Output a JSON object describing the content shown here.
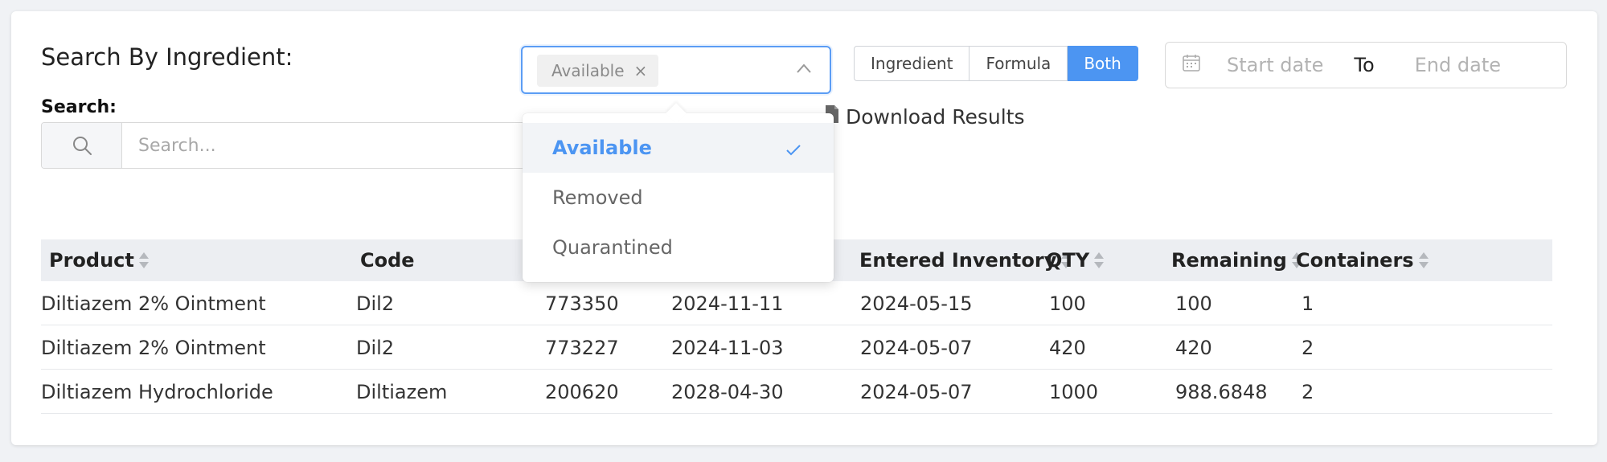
{
  "header": {
    "title": "Search By Ingredient:",
    "search_label": "Search:",
    "search_placeholder": "Search..."
  },
  "status_select": {
    "selected_tag": "Available",
    "options": [
      {
        "label": "Available",
        "selected": true
      },
      {
        "label": "Removed",
        "selected": false
      },
      {
        "label": "Quarantined",
        "selected": false
      }
    ]
  },
  "mode_toggle": {
    "options": [
      "Ingredient",
      "Formula",
      "Both"
    ],
    "active": "Both"
  },
  "date_range": {
    "start_placeholder": "Start date",
    "separator": "To",
    "end_placeholder": "End date"
  },
  "download": {
    "label": "Download Results"
  },
  "table": {
    "columns": [
      "Product",
      "Code",
      "",
      "",
      "Entered Inventory",
      "QTY",
      "Remaining",
      "Containers"
    ],
    "rows": [
      [
        "Diltiazem 2% Ointment",
        "Dil2",
        "773350",
        "2024-11-11",
        "2024-05-15",
        "100",
        "100",
        "1"
      ],
      [
        "Diltiazem 2% Ointment",
        "Dil2",
        "773227",
        "2024-11-03",
        "2024-05-07",
        "420",
        "420",
        "2"
      ],
      [
        "Diltiazem Hydrochloride",
        "Diltiazem",
        "200620",
        "2028-04-30",
        "2024-05-07",
        "1000",
        "988.6848",
        "2"
      ]
    ]
  },
  "colors": {
    "accent": "#4c95f2",
    "focus_border": "#5b9df5",
    "header_bg": "#eceef2"
  }
}
